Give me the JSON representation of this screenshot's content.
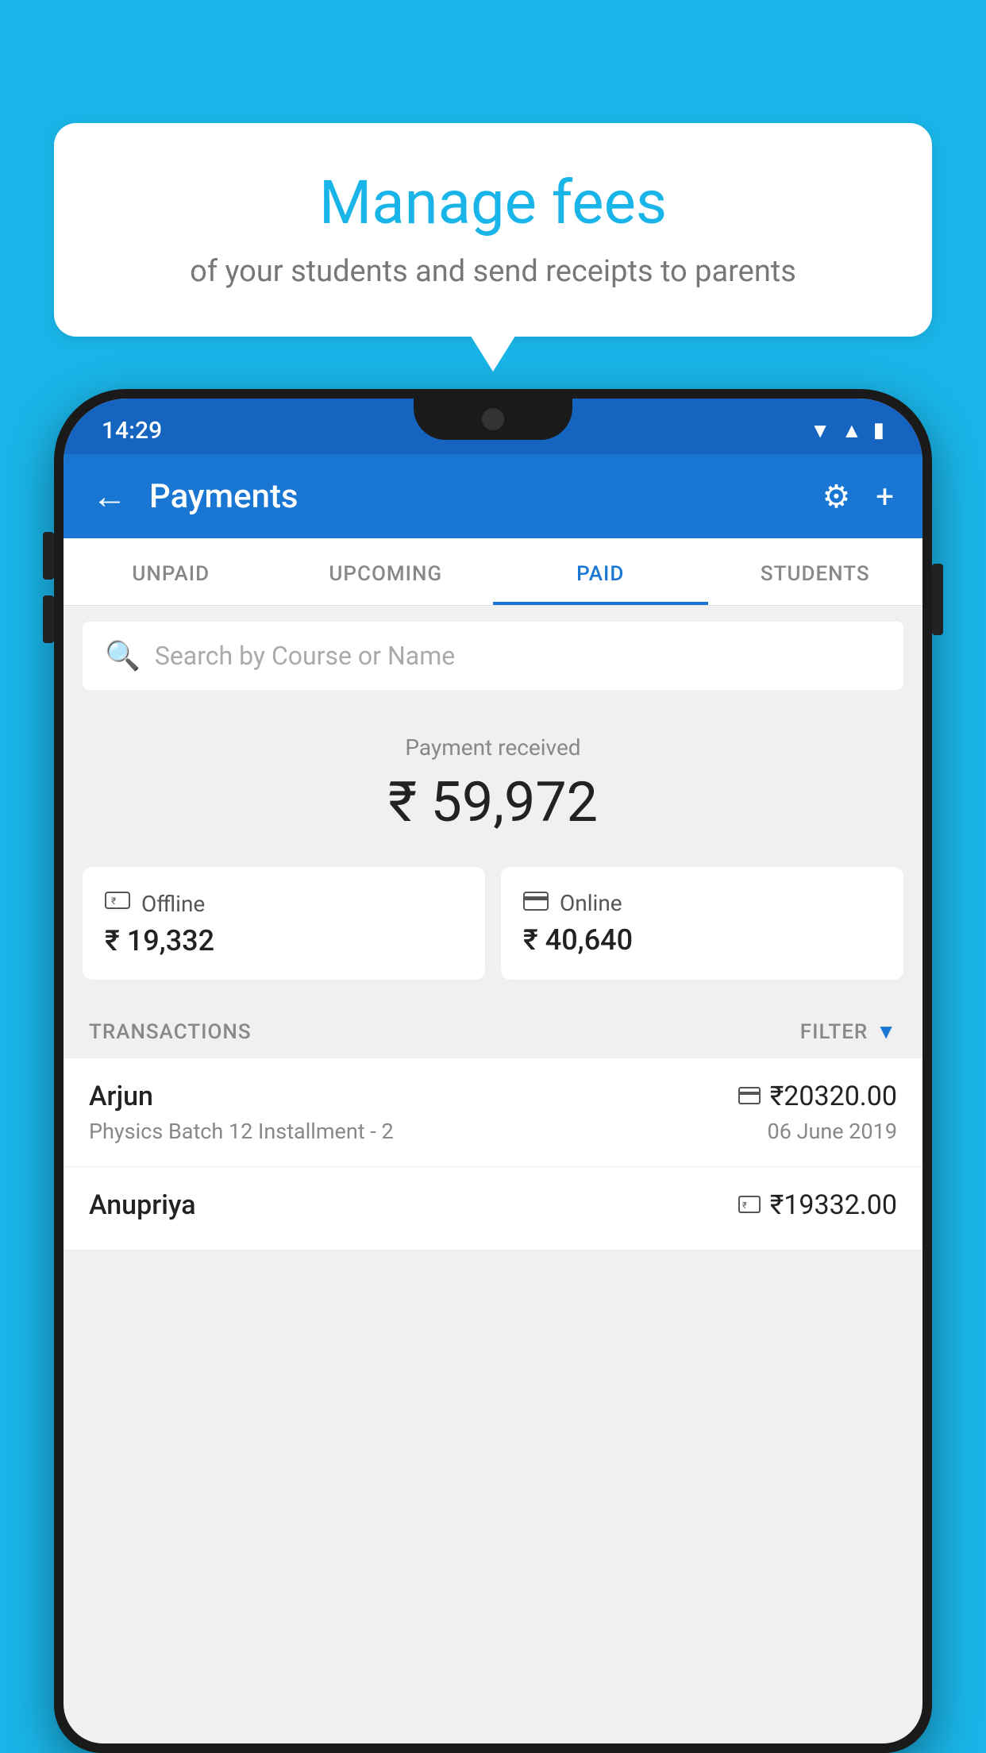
{
  "background_color": "#1ab5e8",
  "speech_bubble": {
    "title": "Manage fees",
    "subtitle": "of your students and send receipts to parents"
  },
  "status_bar": {
    "time": "14:29",
    "icons": [
      "wifi",
      "signal",
      "battery"
    ]
  },
  "app_bar": {
    "title": "Payments",
    "back_icon": "←",
    "settings_icon": "⚙",
    "add_icon": "+"
  },
  "tabs": [
    {
      "label": "UNPAID",
      "active": false
    },
    {
      "label": "UPCOMING",
      "active": false
    },
    {
      "label": "PAID",
      "active": true
    },
    {
      "label": "STUDENTS",
      "active": false
    }
  ],
  "search": {
    "placeholder": "Search by Course or Name"
  },
  "payment_summary": {
    "label": "Payment received",
    "total": "₹ 59,972",
    "offline": {
      "icon": "💳",
      "type": "Offline",
      "amount": "₹ 19,332"
    },
    "online": {
      "icon": "💳",
      "type": "Online",
      "amount": "₹ 40,640"
    }
  },
  "transactions": {
    "label": "TRANSACTIONS",
    "filter_label": "FILTER",
    "rows": [
      {
        "name": "Arjun",
        "amount": "₹20320.00",
        "course": "Physics Batch 12 Installment - 2",
        "date": "06 June 2019",
        "payment_type": "online"
      },
      {
        "name": "Anupriya",
        "amount": "₹19332.00",
        "course": "",
        "date": "",
        "payment_type": "offline"
      }
    ]
  }
}
